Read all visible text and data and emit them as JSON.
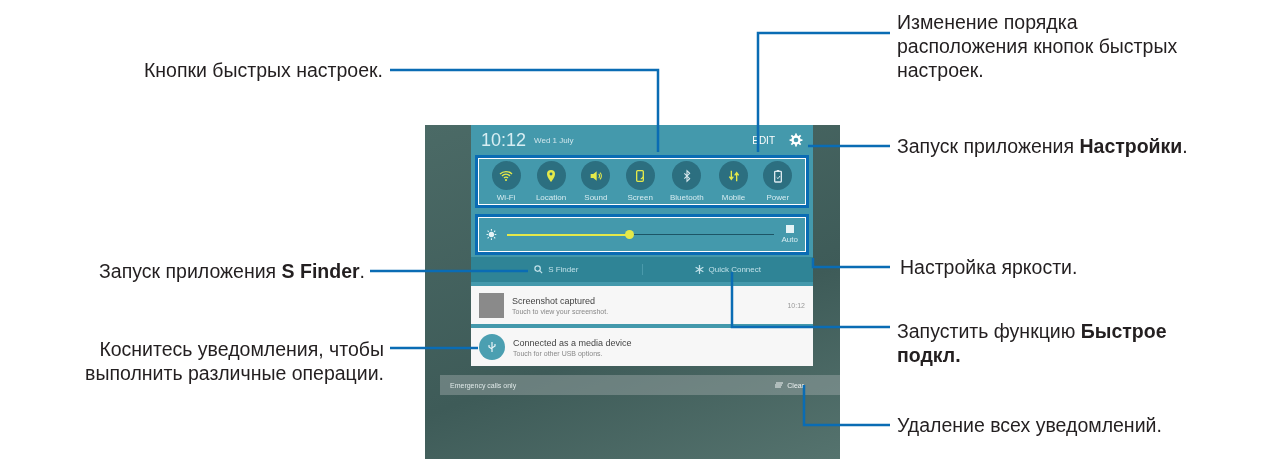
{
  "callouts": {
    "quick_buttons": "Кнопки быстрых настроек.",
    "reorder": "Изменение порядка расположения кнопок быстрых настроек.",
    "settings": "Запуск приложения **Настройки**.",
    "brightness": "Настройка яркости.",
    "s_finder": "Запуск приложения **S Finder**.",
    "quick_connect": "Запустить функцию **Быстрое подкл.**",
    "notification": "Коснитесь уведомления, чтобы выполнить различные операции.",
    "clear_all": "Удаление всех уведомлений."
  },
  "phone": {
    "time": "10:12",
    "date": "Wed 1 July",
    "edit": "EDIT",
    "quick_settings": [
      {
        "label": "Wi-Fi",
        "on": true
      },
      {
        "label": "Location",
        "on": true
      },
      {
        "label": "Sound",
        "on": true
      },
      {
        "label": "Screen",
        "on": true
      },
      {
        "label": "Bluetooth",
        "on": false
      },
      {
        "label": "Mobile",
        "on": true
      },
      {
        "label": "Power",
        "on": false
      }
    ],
    "brightness": {
      "level": 0.46,
      "auto_label": "Auto",
      "auto_checked": true
    },
    "s_finder": "S Finder",
    "quick_connect": "Quick Connect",
    "notifications": [
      {
        "kind": "screenshot",
        "title": "Screenshot captured",
        "text": "Touch to view your screenshot.",
        "time": "10:12"
      },
      {
        "kind": "usb",
        "title": "Connected as a media device",
        "text": "Touch for other USB options."
      }
    ],
    "carrier": "Emergency calls only",
    "clear": "Clear"
  }
}
